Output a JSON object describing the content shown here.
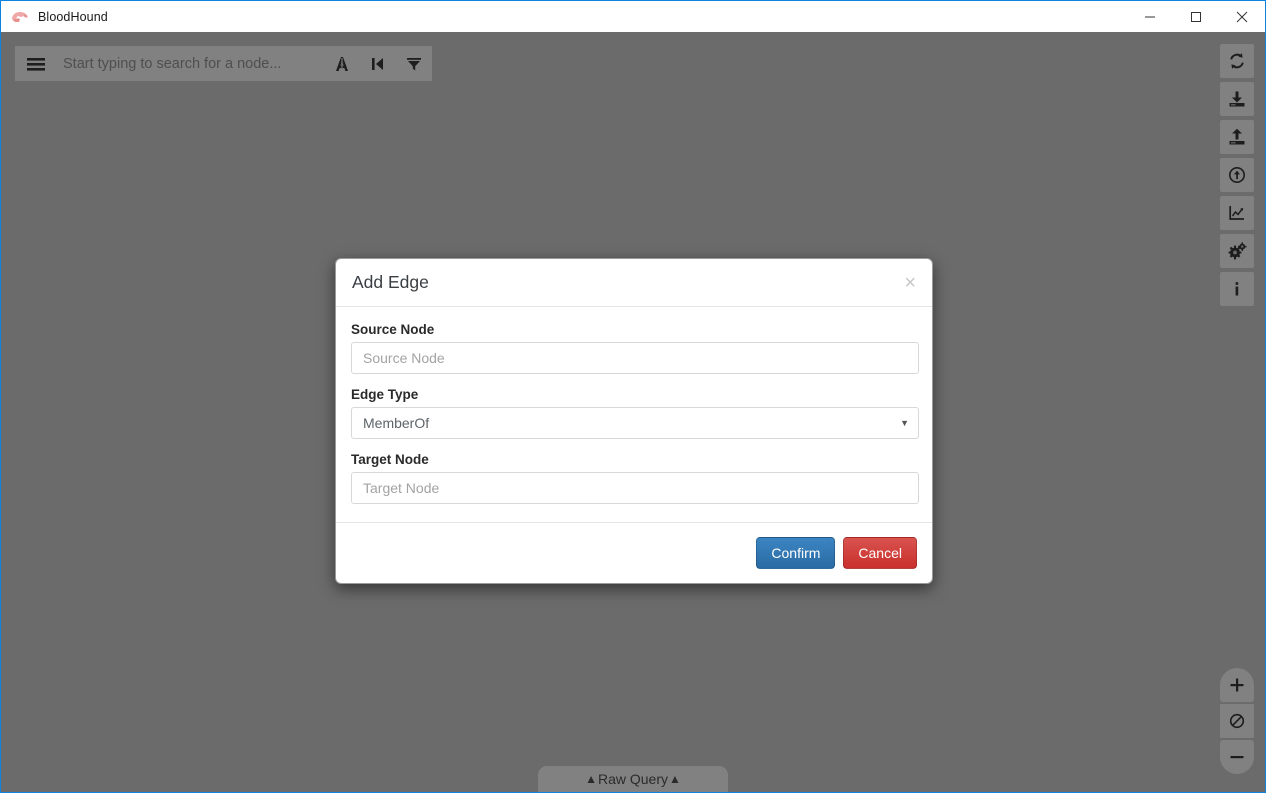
{
  "window": {
    "app_icon": "bloodhound-logo-icon",
    "title": "BloodHound",
    "controls": {
      "minimize": "minimize-icon",
      "maximize": "maximize-icon",
      "close": "close-icon"
    }
  },
  "search": {
    "menu_icon": "hamburger-menu-icon",
    "placeholder": "Start typing to search for a node...",
    "value": "",
    "actions": [
      {
        "name": "pathfinding-icon",
        "title": "Pathfinding"
      },
      {
        "name": "node-shortest-path-icon",
        "title": "Shortest Path"
      },
      {
        "name": "filter-icon",
        "title": "Filter"
      }
    ]
  },
  "toolbar": {
    "items": [
      {
        "name": "refresh-icon",
        "title": "Refresh"
      },
      {
        "name": "download-icon",
        "title": "Export Graph"
      },
      {
        "name": "upload-icon",
        "title": "Import Graph"
      },
      {
        "name": "upload-circle-icon",
        "title": "Upload Data"
      },
      {
        "name": "chart-icon",
        "title": "Database Info"
      },
      {
        "name": "settings-gears-icon",
        "title": "Settings"
      },
      {
        "name": "info-icon",
        "title": "About"
      }
    ]
  },
  "zoom_controls": {
    "zoom_in": {
      "name": "plus-icon",
      "label": "+"
    },
    "reset": {
      "name": "no-entry-icon",
      "label": "⊘"
    },
    "zoom_out": {
      "name": "minus-icon",
      "label": "−"
    }
  },
  "raw_query": {
    "label": "Raw Query",
    "caret_left": "▲",
    "caret_right": "▲"
  },
  "modal": {
    "title": "Add Edge",
    "close_label": "×",
    "fields": {
      "source": {
        "label": "Source Node",
        "placeholder": "Source Node",
        "value": ""
      },
      "edge_type": {
        "label": "Edge Type",
        "selected": "MemberOf",
        "options": [
          "MemberOf"
        ]
      },
      "target": {
        "label": "Target Node",
        "placeholder": "Target Node",
        "value": ""
      }
    },
    "buttons": {
      "confirm": "Confirm",
      "cancel": "Cancel"
    }
  },
  "colors": {
    "accent_blue": "#2d74ae",
    "danger_red": "#cd4448",
    "window_border": "#0a84e0",
    "canvas_overlay": "#6b6b6b",
    "modal_bg": "#ffffff"
  }
}
